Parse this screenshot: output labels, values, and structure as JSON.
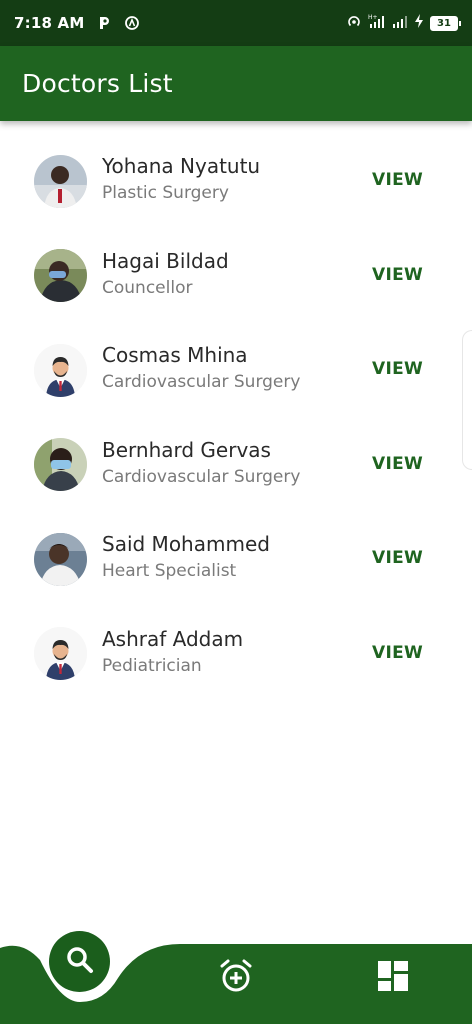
{
  "status_bar": {
    "time": "7:18 AM",
    "app_icon": "parking-p-icon",
    "icons": [
      "hotspot-icon",
      "signal-h-icon",
      "signal-icon",
      "charging-bolt-icon"
    ],
    "battery": "31"
  },
  "app_bar": {
    "title": "Doctors List",
    "color": "#1f6420"
  },
  "doctors": [
    {
      "name": "Yohana Nyatutu",
      "specialty": "Plastic Surgery",
      "action": "VIEW",
      "avatar": "photo"
    },
    {
      "name": "Hagai Bildad",
      "specialty": "Councellor",
      "action": "VIEW",
      "avatar": "photo"
    },
    {
      "name": "Cosmas Mhina",
      "specialty": "Cardiovascular Surgery",
      "action": "VIEW",
      "avatar": "default-avatar"
    },
    {
      "name": "Bernhard Gervas",
      "specialty": "Cardiovascular Surgery",
      "action": "VIEW",
      "avatar": "photo"
    },
    {
      "name": "Said Mohammed",
      "specialty": "Heart Specialist",
      "action": "VIEW",
      "avatar": "photo"
    },
    {
      "name": "Ashraf Addam",
      "specialty": "Pediatrician",
      "action": "VIEW",
      "avatar": "default-avatar"
    }
  ],
  "bottom_nav": {
    "items": [
      "search-icon",
      "add-alarm-icon",
      "dashboard-icon"
    ],
    "active": "search-icon",
    "color": "#1f6420"
  }
}
